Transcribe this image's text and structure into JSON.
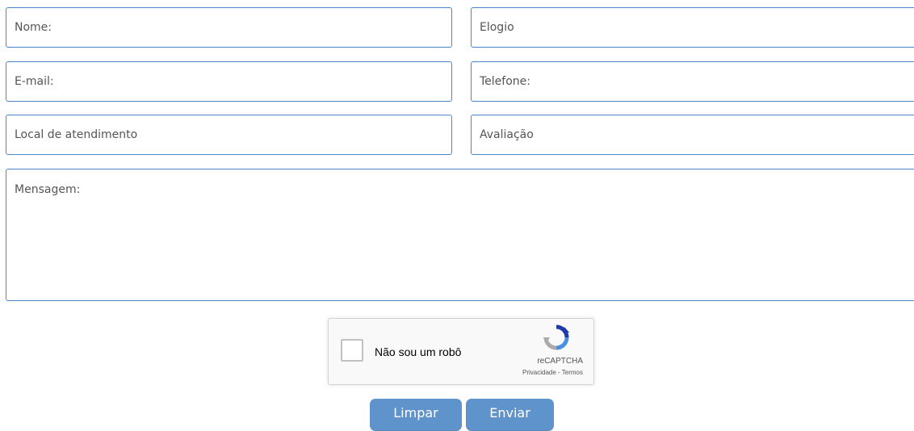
{
  "form": {
    "nome_placeholder": "Nome:",
    "elogio_placeholder": "Elogio",
    "email_placeholder": "E-mail:",
    "telefone_placeholder": "Telefone:",
    "local_placeholder": "Local de atendimento",
    "avaliacao_placeholder": "Avaliação",
    "mensagem_placeholder": "Mensagem:"
  },
  "captcha": {
    "label": "Não sou um robô",
    "brand": "reCAPTCHA",
    "privacy": "Privacidade",
    "separator": " - ",
    "terms": "Termos",
    "icon": "recaptcha-logo",
    "checked": false
  },
  "buttons": {
    "clear_label": "Limpar",
    "submit_label": "Enviar"
  },
  "colors": {
    "field_border": "#4a86c8",
    "button_bg": "#5f93cc",
    "captcha_blue": "#4a90e2",
    "captcha_gray": "#aaaaaa",
    "captcha_dark": "#1c3aa9"
  }
}
